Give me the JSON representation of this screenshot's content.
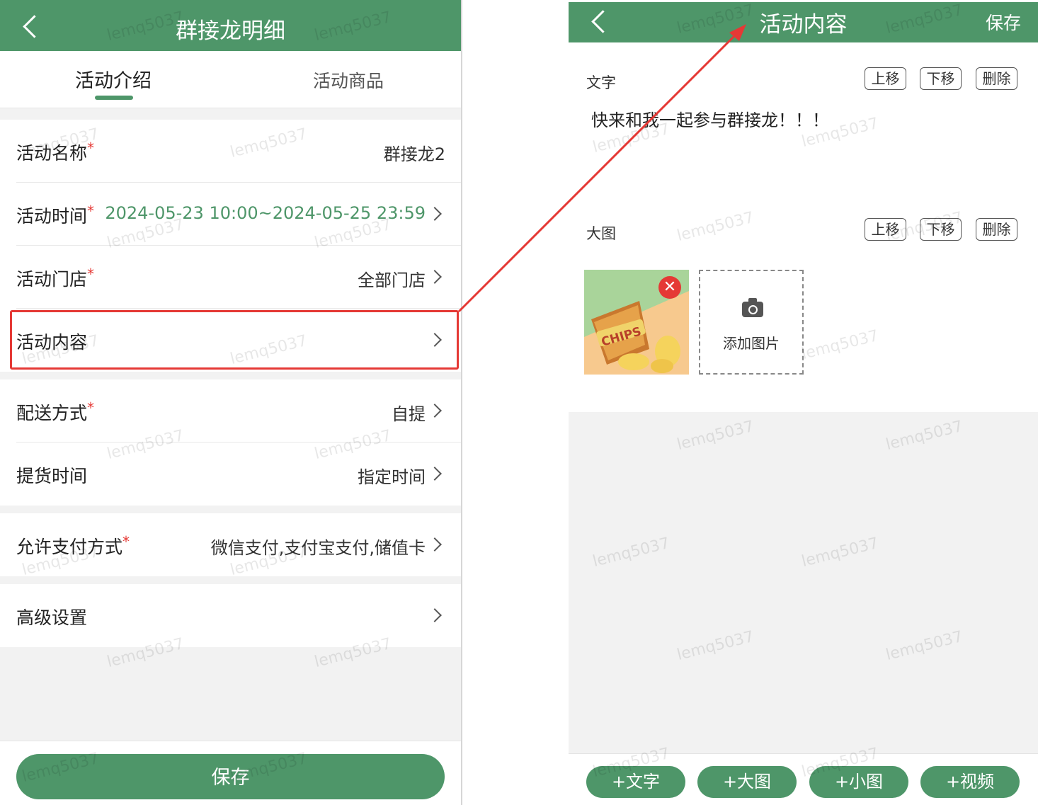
{
  "left": {
    "header": {
      "title": "群接龙明细"
    },
    "tabs": [
      {
        "label": "活动介绍",
        "active": true
      },
      {
        "label": "活动商品",
        "active": false
      }
    ],
    "rows": {
      "name": {
        "label": "活动名称",
        "required": "*",
        "value": "群接龙2"
      },
      "time": {
        "label": "活动时间",
        "required": "*",
        "value": "2024-05-23 10:00~2024-05-25 23:59"
      },
      "store": {
        "label": "活动门店",
        "required": "*",
        "value": "全部门店"
      },
      "content": {
        "label": "活动内容"
      },
      "delivery": {
        "label": "配送方式",
        "required": "*",
        "value": "自提"
      },
      "pickup": {
        "label": "提货时间",
        "value": "指定时间"
      },
      "payment": {
        "label": "允许支付方式",
        "required": "*",
        "value": "微信支付,支付宝支付,储值卡"
      },
      "advanced": {
        "label": "高级设置"
      }
    },
    "footer": {
      "save_label": "保存"
    }
  },
  "right": {
    "header": {
      "title": "活动内容",
      "save_label": "保存"
    },
    "text_section": {
      "label": "文字",
      "buttons": {
        "up": "上移",
        "down": "下移",
        "delete": "删除"
      },
      "content": "快来和我一起参与群接龙！！！"
    },
    "image_section": {
      "label": "大图",
      "buttons": {
        "up": "上移",
        "down": "下移",
        "delete": "删除"
      },
      "thumbnail_text": "CHIPS",
      "add_image_label": "添加图片"
    },
    "add_buttons": {
      "text": "+文字",
      "big_image": "+大图",
      "small_image": "+小图",
      "video": "+视频"
    }
  },
  "watermark": "lemq5037",
  "colors": {
    "primary_green": "#4e9669",
    "required_red": "#e53935",
    "highlight_red": "#e53935"
  }
}
